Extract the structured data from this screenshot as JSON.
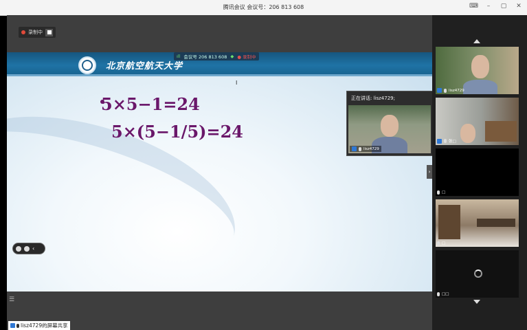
{
  "window": {
    "title": "腾讯会议 会议号：206 813 608",
    "controls": [
      "⌨",
      "–",
      "▢",
      "✕"
    ]
  },
  "recording": {
    "label": "录制中"
  },
  "slide": {
    "school": "北京航空航天大学",
    "equation1": "5×5−1=24",
    "equation2": "5×(5−1/5)=24"
  },
  "meeting_info": {
    "signal": "ıll",
    "number": "会议号 206 813 608",
    "shield": "◆",
    "rec": "● 录制中"
  },
  "speaker": {
    "label": "正在讲话: lisz4729;",
    "name": "lisz4729"
  },
  "participants": [
    {
      "name": "lisz4729"
    },
    {
      "name": "张□"
    },
    {
      "name": "□"
    },
    {
      "name": "□"
    },
    {
      "name": "□□"
    }
  ],
  "share": {
    "label": "lisz4729的屏幕共享"
  },
  "colors": {
    "equation": "#6a176a",
    "header": "#1f73a5",
    "accent": "#2f78d4"
  }
}
